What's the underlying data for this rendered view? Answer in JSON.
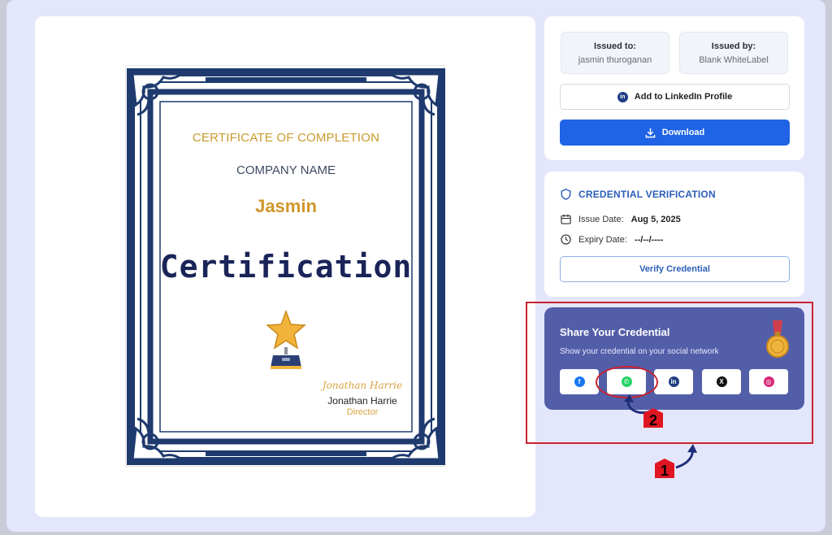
{
  "certificate": {
    "title": "CERTIFICATE OF COMPLETION",
    "company": "COMPANY NAME",
    "recipient_name": "Jasmin",
    "main_heading": "Certification",
    "signature_script": "Jonathan Harrie",
    "signer_name": "Jonathan Harrie",
    "signer_role": "Director"
  },
  "issued": {
    "to_label": "Issued to:",
    "to_value": "jasmin thuroganan",
    "by_label": "Issued by:",
    "by_value": "Blank WhiteLabel",
    "linkedin_label": "Add to LinkedIn Profile",
    "download_label": "Download"
  },
  "verification": {
    "title": "CREDENTIAL VERIFICATION",
    "issue_label": "Issue Date:",
    "issue_value": "Aug 5, 2025",
    "expiry_label": "Expiry Date:",
    "expiry_value": "--/--/----",
    "verify_label": "Verify Credential"
  },
  "share": {
    "title": "Share Your Credential",
    "subtitle": "Show your credential on your social network",
    "networks": [
      {
        "name": "facebook",
        "icon": "facebook-icon",
        "glyph": "f",
        "color": "#1877f2"
      },
      {
        "name": "whatsapp",
        "icon": "whatsapp-icon",
        "glyph": "✆",
        "color": "#25d366"
      },
      {
        "name": "linkedin",
        "icon": "linkedin-icon",
        "glyph": "in",
        "color": "#1f3f84"
      },
      {
        "name": "x",
        "icon": "x-icon",
        "glyph": "X",
        "color": "#111111"
      },
      {
        "name": "instagram",
        "icon": "instagram-icon",
        "glyph": "◎",
        "color": "#d62976"
      }
    ]
  },
  "annotations": {
    "marker_1": "1",
    "marker_2": "2",
    "color": "#c9232e"
  },
  "colors": {
    "accent_blue": "#1f63e6",
    "share_bg": "#535ea9",
    "cert_navy": "#1e3a6e",
    "gold": "#d0962a"
  }
}
